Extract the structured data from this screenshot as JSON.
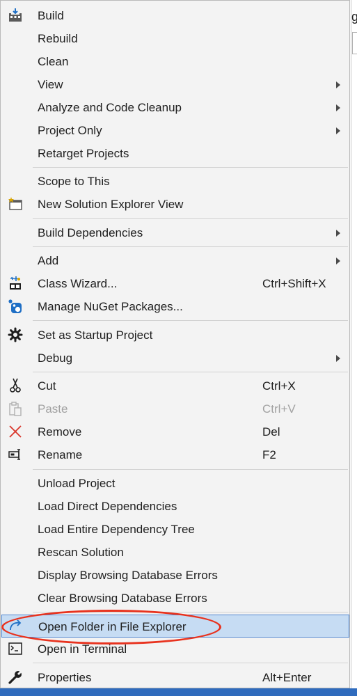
{
  "menu": {
    "items": [
      {
        "label": "Build",
        "icon": "build-icon"
      },
      {
        "label": "Rebuild"
      },
      {
        "label": "Clean"
      },
      {
        "label": "View",
        "submenu": true
      },
      {
        "label": "Analyze and Code Cleanup",
        "submenu": true
      },
      {
        "label": "Project Only",
        "submenu": true
      },
      {
        "label": "Retarget Projects"
      },
      {
        "label": "Scope to This"
      },
      {
        "label": "New Solution Explorer View",
        "icon": "new-explorer-view-icon"
      },
      {
        "label": "Build Dependencies",
        "submenu": true
      },
      {
        "label": "Add",
        "submenu": true
      },
      {
        "label": "Class Wizard...",
        "shortcut": "Ctrl+Shift+X",
        "icon": "class-wizard-icon"
      },
      {
        "label": "Manage NuGet Packages...",
        "icon": "nuget-icon"
      },
      {
        "label": "Set as Startup Project",
        "icon": "gear-icon"
      },
      {
        "label": "Debug",
        "submenu": true
      },
      {
        "label": "Cut",
        "shortcut": "Ctrl+X",
        "icon": "scissors-icon"
      },
      {
        "label": "Paste",
        "shortcut": "Ctrl+V",
        "icon": "paste-icon",
        "disabled": true
      },
      {
        "label": "Remove",
        "shortcut": "Del",
        "icon": "close-icon"
      },
      {
        "label": "Rename",
        "shortcut": "F2",
        "icon": "rename-icon"
      },
      {
        "label": "Unload Project"
      },
      {
        "label": "Load Direct Dependencies"
      },
      {
        "label": "Load Entire Dependency Tree"
      },
      {
        "label": "Rescan Solution"
      },
      {
        "label": "Display Browsing Database Errors"
      },
      {
        "label": "Clear Browsing Database Errors"
      },
      {
        "label": "Open Folder in File Explorer",
        "icon": "open-folder-arrow-icon",
        "highlighted": true
      },
      {
        "label": "Open in Terminal",
        "icon": "terminal-icon"
      },
      {
        "label": "Properties",
        "shortcut": "Alt+Enter",
        "icon": "wrench-icon"
      }
    ]
  },
  "colors": {
    "menu_background": "#f3f3f3",
    "highlight_background": "#c6dcf3",
    "highlight_border": "#4f86d1",
    "annotation": "#e8321e",
    "disabled_text": "#a2a2a2",
    "accent_blue": "#1f6fc5"
  }
}
